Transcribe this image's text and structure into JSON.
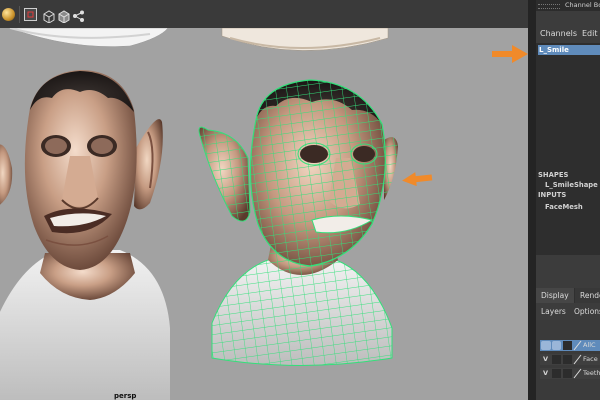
{
  "toolbar": {
    "icons": [
      "sphere-shaded-icon",
      "isolate-select-icon",
      "wireframe-cube-icon",
      "texture-cube-icon",
      "node-network-icon"
    ]
  },
  "viewport": {
    "camera_label": "persp",
    "background": "#a2a2a2",
    "wireframe_color": "#33e07a",
    "arrow_color": "#f08a2a"
  },
  "channel_box": {
    "title": "Channel Box",
    "menu": [
      "Channels",
      "Edit"
    ],
    "selected_object": "L_Smile",
    "shapes_header": "SHAPES",
    "shape_name": "L_SmileShape",
    "inputs_header": "INPUTS",
    "input_name": "FaceMesh"
  },
  "layer_editor": {
    "tabs": [
      "Display",
      "Render"
    ],
    "menu": [
      "Layers",
      "Options"
    ],
    "rows": [
      {
        "v": "",
        "name": "AllC"
      },
      {
        "v": "V",
        "name": "Face"
      },
      {
        "v": "V",
        "name": "Teeth"
      }
    ]
  }
}
